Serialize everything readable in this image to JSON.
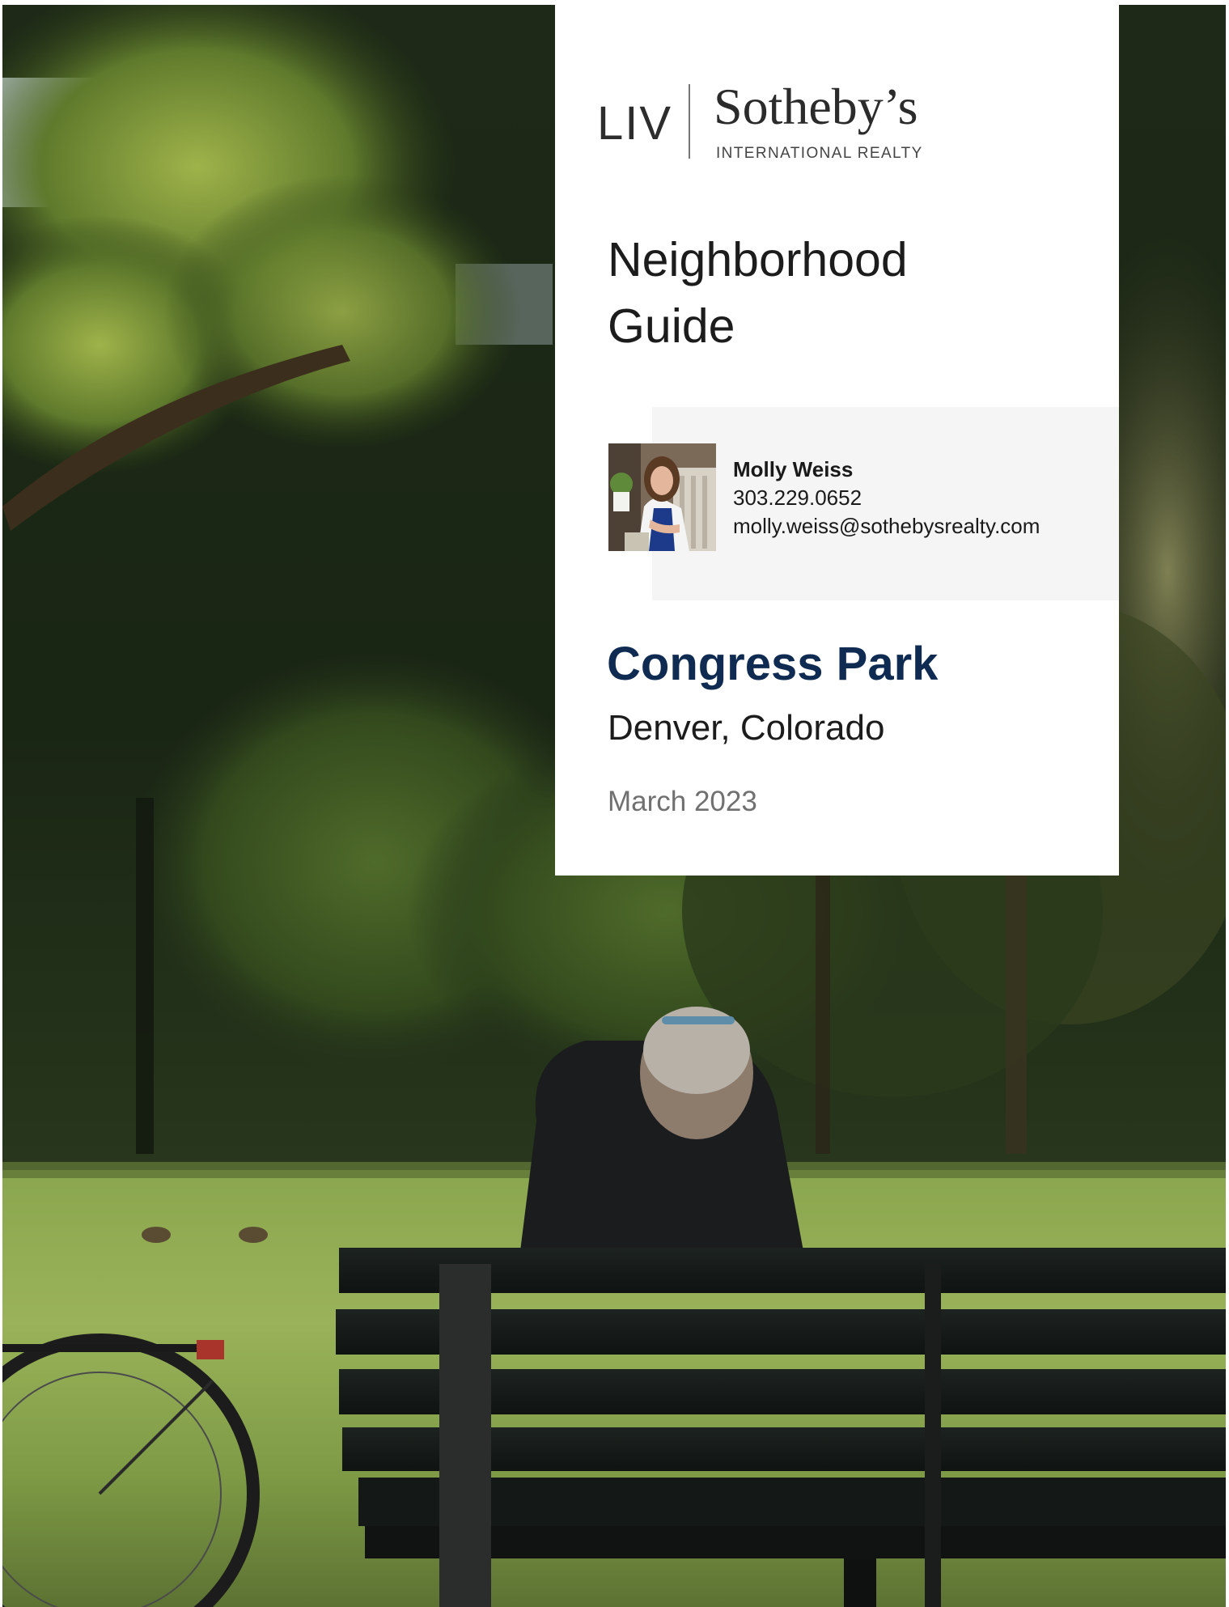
{
  "brand": {
    "prefix": "LIV",
    "name": "Sotheby’s",
    "tagline": "INTERNATIONAL REALTY"
  },
  "guide": {
    "title_line1": "Neighborhood",
    "title_line2": "Guide"
  },
  "agent": {
    "name": "Molly Weiss",
    "phone": "303.229.0652",
    "email": "molly.weiss@sothebysrealty.com"
  },
  "location": {
    "neighborhood": "Congress Park",
    "city": "Denver, Colorado"
  },
  "date": "March 2023",
  "colors": {
    "accent": "#0f2b52",
    "panel_bg": "#ffffff",
    "card_bg": "#f5f5f5"
  }
}
